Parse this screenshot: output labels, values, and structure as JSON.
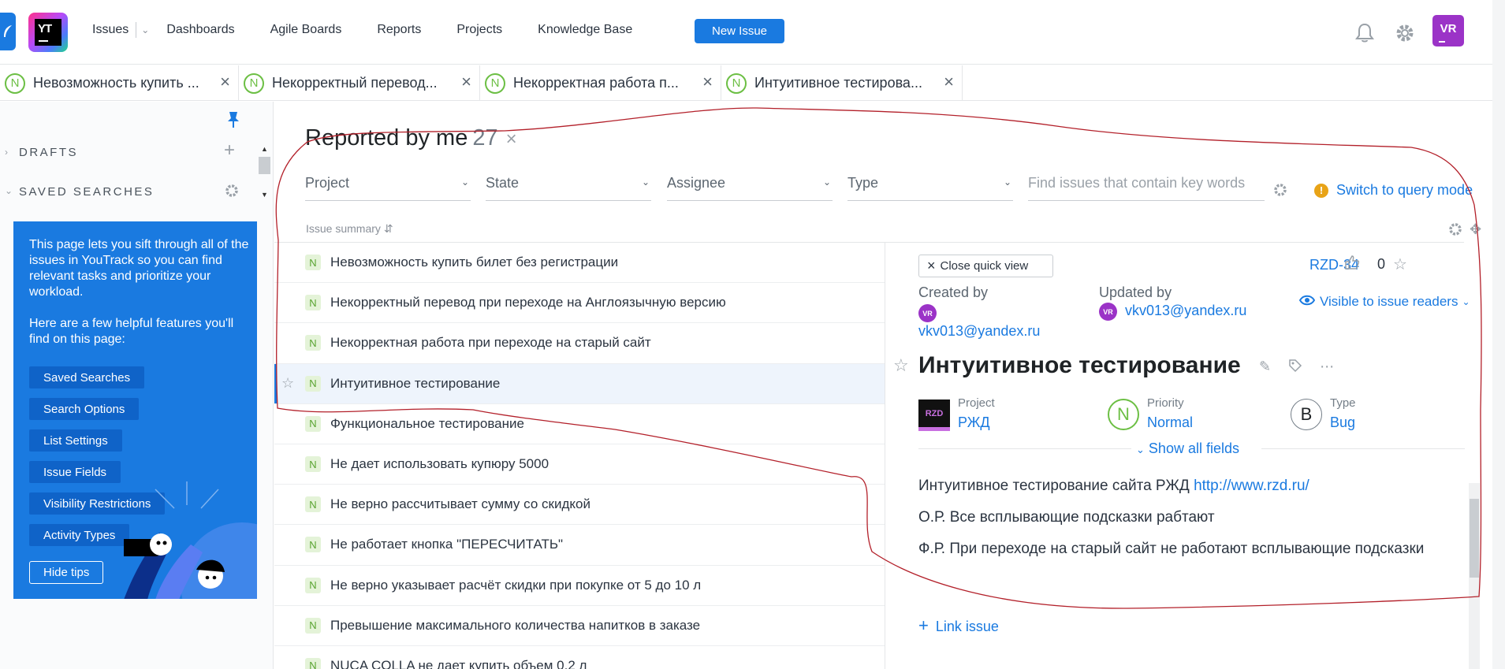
{
  "header": {
    "nav": {
      "issues": "Issues",
      "dashboards": "Dashboards",
      "agile_boards": "Agile Boards",
      "reports": "Reports",
      "projects": "Projects",
      "knowledge_base": "Knowledge Base"
    },
    "logo_text": "YT",
    "new_issue": "New Issue",
    "avatar_initials": "VR"
  },
  "tabs": [
    {
      "badge": "N",
      "label": "Невозможность купить ..."
    },
    {
      "badge": "N",
      "label": "Некорректный перевод..."
    },
    {
      "badge": "N",
      "label": "Некорректная работа п..."
    },
    {
      "badge": "N",
      "label": "Интуитивное тестирова..."
    }
  ],
  "sidebar": {
    "drafts": "DRAFTS",
    "saved_searches": "SAVED SEARCHES",
    "tips": {
      "intro": "This page lets you sift through all of the issues in YouTrack so you can find relevant tasks and prioritize your workload.",
      "features": "Here are a few helpful features you'll find on this page:",
      "buttons": [
        "Saved Searches",
        "Search Options",
        "List Settings",
        "Issue Fields",
        "Visibility Restrictions",
        "Activity Types"
      ],
      "hide": "Hide tips"
    }
  },
  "main": {
    "title": "Reported by me",
    "count": "27",
    "filters": {
      "project": "Project",
      "state": "State",
      "assignee": "Assignee",
      "type": "Type",
      "search_placeholder": "Find issues that contain key words"
    },
    "query_mode": "Switch to query mode",
    "summary_header": "Issue summary",
    "issues": [
      {
        "badge": "N",
        "summary": "Невозможность купить билет без регистрации"
      },
      {
        "badge": "N",
        "summary": "Некорректный перевод при переходе на Англоязычную версию"
      },
      {
        "badge": "N",
        "summary": "Некорректная работа при переходе на старый сайт"
      },
      {
        "badge": "N",
        "summary": "Интуитивное тестирование"
      },
      {
        "badge": "N",
        "summary": "Функциональное тестирование"
      },
      {
        "badge": "N",
        "summary": "Не дает использовать купюру 5000"
      },
      {
        "badge": "N",
        "summary": "Не верно рассчитывает сумму со скидкой"
      },
      {
        "badge": "N",
        "summary": "Не работает кнопка \"ПЕРЕСЧИТАТЬ\""
      },
      {
        "badge": "N",
        "summary": "Не верно указывает расчёт скидки при покупке от 5 до 10 л"
      },
      {
        "badge": "N",
        "summary": "Превышение максимального количества напитков в заказе"
      },
      {
        "badge": "N",
        "summary": "NUCA COLLA не дает купить объем 0,2 л"
      }
    ]
  },
  "quick_view": {
    "close": "Close quick view",
    "issue_id": "RZD-34",
    "votes": "0",
    "created_by_label": "Created by",
    "created_by": "vkv013@yandex.ru",
    "updated_by_label": "Updated by",
    "updated_by": "vkv013@yandex.ru",
    "avatar_initials": "VR",
    "visibility": "Visible to issue readers",
    "title": "Интуитивное тестирование",
    "fields": {
      "project_label": "Project",
      "project_value": "РЖД",
      "project_icon": "RZD",
      "priority_label": "Priority",
      "priority_value": "Normal",
      "priority_icon": "N",
      "type_label": "Type",
      "type_value": "Bug",
      "type_icon": "B"
    },
    "show_all": "Show all fields",
    "description": {
      "line1": "Интуитивное тестирование сайта РЖД",
      "link": "http://www.rzd.ru/",
      "line2": "О.Р. Все всплывающие подсказки рабтают",
      "line3": "Ф.Р. При переходе на старый сайт не работают всплывающие подсказки"
    },
    "link_issue": "Link issue"
  },
  "colors": {
    "accent": "#1a7ae0",
    "priority_normal": "#6cbf44",
    "avatar": "#9b33c7",
    "annotation": "#b3202a"
  }
}
